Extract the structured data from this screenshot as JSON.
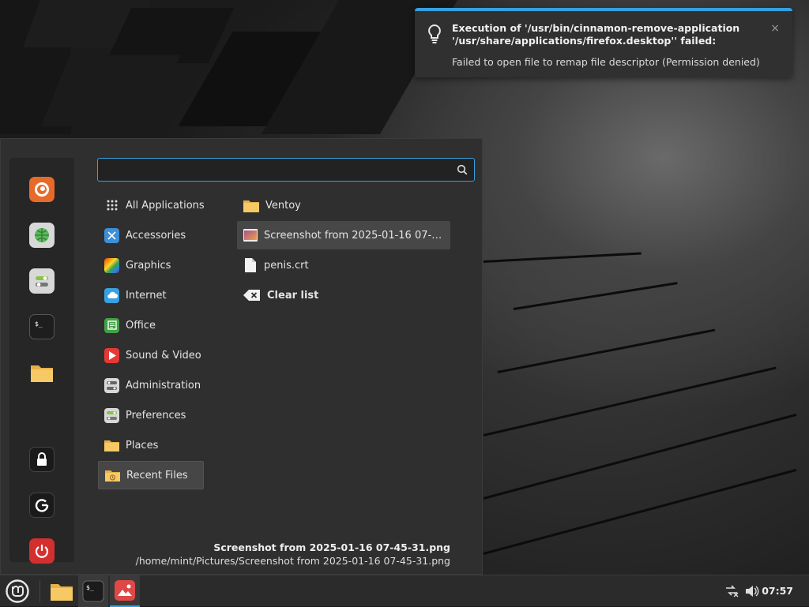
{
  "notification": {
    "title": "Execution of '/usr/bin/cinnamon-remove-application '/usr/share/applications/firefox.desktop'' failed:",
    "body": "Failed to open file to remap file descriptor (Permission denied)",
    "close": "×"
  },
  "menu": {
    "search": {
      "value": "",
      "placeholder": ""
    },
    "favorites": [
      "firefox-icon",
      "webapps-icon",
      "settings-icon",
      "terminal-icon",
      "files-icon"
    ],
    "session": [
      "lock-icon",
      "logout-icon",
      "power-icon"
    ],
    "categories": [
      {
        "label": "All Applications",
        "icon": "grid-icon"
      },
      {
        "label": "Accessories",
        "icon": "accessories-icon"
      },
      {
        "label": "Graphics",
        "icon": "graphics-icon"
      },
      {
        "label": "Internet",
        "icon": "internet-icon"
      },
      {
        "label": "Office",
        "icon": "office-icon"
      },
      {
        "label": "Sound & Video",
        "icon": "sound-video-icon"
      },
      {
        "label": "Administration",
        "icon": "administration-icon"
      },
      {
        "label": "Preferences",
        "icon": "preferences-icon"
      },
      {
        "label": "Places",
        "icon": "places-icon"
      },
      {
        "label": "Recent Files",
        "icon": "recent-files-icon",
        "selected": true
      }
    ],
    "recent": [
      {
        "label": "Ventoy",
        "icon": "folder-icon"
      },
      {
        "label": "Screenshot from 2025-01-16 07-45-31.png",
        "icon": "image-icon",
        "hover": true
      },
      {
        "label": "penis.crt",
        "icon": "file-icon"
      },
      {
        "label": "Clear list",
        "icon": "clear-icon"
      }
    ],
    "footer": {
      "title": "Screenshot from 2025-01-16 07-45-31.png",
      "path": "/home/mint/Pictures/Screenshot from 2025-01-16 07-45-31.png"
    }
  },
  "taskbar": {
    "clock": "07:57"
  },
  "colors": {
    "accent": "#35a1e0",
    "panel": "#2f2f2f",
    "taskbar": "#2b2b2b"
  }
}
